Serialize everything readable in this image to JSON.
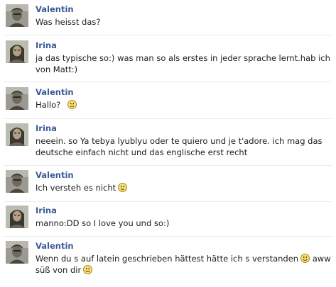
{
  "messages": [
    {
      "sender": "Valentin",
      "text": "Was heisst das?",
      "emoji": null,
      "tail": null,
      "avatar": "valentin"
    },
    {
      "sender": "Irina",
      "text": "ja das typische so:) was man so als erstes in jeder sprache lernt.hab ich von Matt:)",
      "emoji": null,
      "tail": null,
      "avatar": "irina"
    },
    {
      "sender": "Valentin",
      "text": "Hallo?",
      "emoji": "neutral-face-icon",
      "tail": null,
      "avatar": "valentin"
    },
    {
      "sender": "Irina",
      "text": "neeein. so Ya tebya lyublyu oder te quiero und je t'adore. ich mag das deutsche einfach nicht und das englische erst recht",
      "emoji": null,
      "tail": null,
      "avatar": "irina"
    },
    {
      "sender": "Valentin",
      "text": "Ich versteh es nicht",
      "emoji": "neutral-face-icon",
      "tail": null,
      "avatar": "valentin"
    },
    {
      "sender": "Irina",
      "text": "manno:DD so I love you und so:)",
      "emoji": null,
      "tail": null,
      "avatar": "irina"
    },
    {
      "sender": "Valentin",
      "text": "Wenn du s auf latein geschrieben hättest hätte ich s verstanden",
      "emoji": "smiley-face-icon",
      "tail": "aww süß von dir",
      "avatar": "valentin"
    }
  ],
  "colors": {
    "sender_name": "#3b5998",
    "message_text": "#1c1c1c",
    "divider": "#e9ebee",
    "emoji_fill": "#f7e07a",
    "emoji_outline": "#a8891e"
  }
}
